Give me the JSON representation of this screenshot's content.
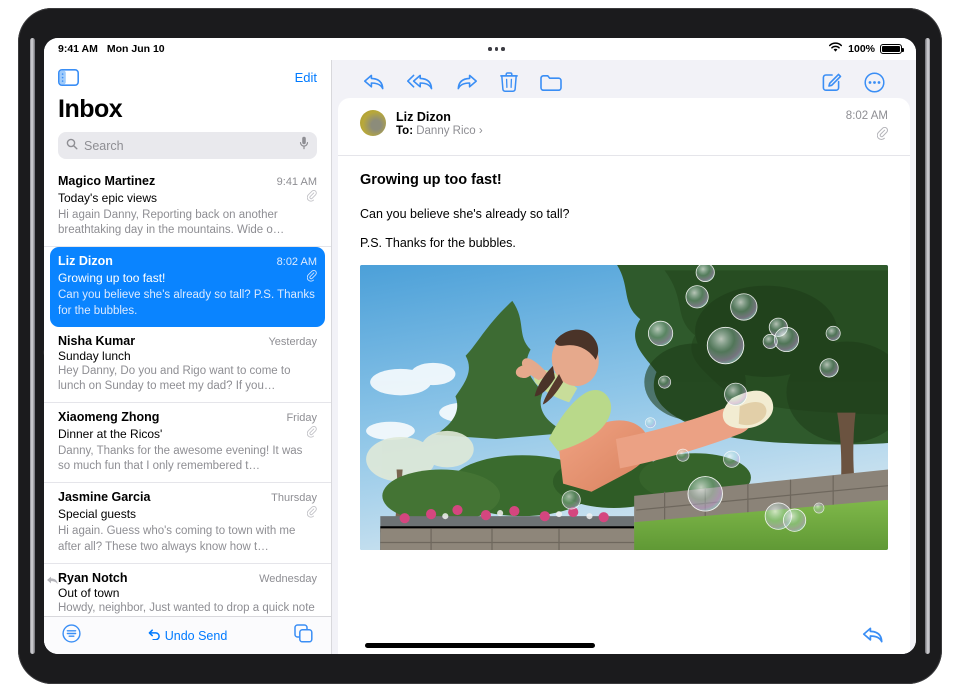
{
  "status_bar": {
    "time": "9:41 AM",
    "date": "Mon Jun 10",
    "wifi_icon": "wifi-icon",
    "battery_percent": "100%",
    "battery_icon": "battery-icon",
    "multitasking_icon": "multitasking-dots-icon"
  },
  "mail_list": {
    "sidebar_toggle_icon": "sidebar-toggle-icon",
    "edit_label": "Edit",
    "title": "Inbox",
    "search": {
      "placeholder": "Search",
      "search_icon": "search-icon",
      "mic_icon": "microphone-icon"
    },
    "messages": [
      {
        "sender": "Magico Martinez",
        "time": "9:41 AM",
        "subject": "Today's epic views",
        "preview": "Hi again Danny, Reporting back on another breathtaking day in the mountains. Wide o…",
        "has_attachment": true,
        "selected": false,
        "replied": false
      },
      {
        "sender": "Liz Dizon",
        "time": "8:02 AM",
        "subject": "Growing up too fast!",
        "preview": "Can you believe she's already so tall? P.S. Thanks for the bubbles.",
        "has_attachment": true,
        "selected": true,
        "replied": false
      },
      {
        "sender": "Nisha Kumar",
        "time": "Yesterday",
        "subject": "Sunday lunch",
        "preview": "Hey Danny, Do you and Rigo want to come to lunch on Sunday to meet my dad? If you…",
        "has_attachment": false,
        "selected": false,
        "replied": false
      },
      {
        "sender": "Xiaomeng Zhong",
        "time": "Friday",
        "subject": "Dinner at the Ricos'",
        "preview": "Danny, Thanks for the awesome evening! It was so much fun that I only remembered t…",
        "has_attachment": true,
        "selected": false,
        "replied": false
      },
      {
        "sender": "Jasmine Garcia",
        "time": "Thursday",
        "subject": "Special guests",
        "preview": "Hi again. Guess who's coming to town with me after all? These two always know how t…",
        "has_attachment": true,
        "selected": false,
        "replied": false
      },
      {
        "sender": "Ryan Notch",
        "time": "Wednesday",
        "subject": "Out of town",
        "preview": "Howdy, neighbor, Just wanted to drop a quick note to let you know we're leaving T…",
        "has_attachment": false,
        "selected": false,
        "replied": true
      }
    ],
    "bottom_bar": {
      "filter_icon": "filter-icon",
      "undo_send_label": "Undo Send",
      "undo_icon": "undo-arrow-icon",
      "duplicate_icon": "duplicate-icon"
    }
  },
  "message_view": {
    "toolbar": [
      {
        "icon": "reply-icon",
        "label": "Reply"
      },
      {
        "icon": "reply-all-icon",
        "label": "Reply All"
      },
      {
        "icon": "forward-icon",
        "label": "Forward"
      },
      {
        "icon": "trash-icon",
        "label": "Delete"
      },
      {
        "icon": "folder-icon",
        "label": "Move to Folder"
      }
    ],
    "toolbar_right": [
      {
        "icon": "compose-icon",
        "label": "New Message"
      },
      {
        "icon": "more-options-icon",
        "label": "More"
      }
    ],
    "header": {
      "avatar_icon": "avatar",
      "sender": "Liz Dizon",
      "to_label": "To:",
      "recipient": "Danny Rico",
      "disclosure_icon": "chevron-right-icon",
      "time": "8:02 AM",
      "attachment_icon": "paperclip-icon"
    },
    "subject": "Growing up too fast!",
    "paragraphs": [
      "Can you believe she's already so tall?",
      "P.S. Thanks for the bubbles."
    ],
    "attachment_photo": {
      "alt": "Girl in peach overalls kicking her leg up among floating soap bubbles in a sunny garden with evergreen trees, a stone wall and green lawn",
      "name": "bubbles-photo"
    },
    "reply_button_icon": "reply-icon"
  },
  "colors": {
    "accent_blue": "#007aff",
    "selection_blue": "#0a84ff",
    "secondary_text": "#8e8e93",
    "separator": "#e5e5ea",
    "pane_background": "#f2f2f7"
  }
}
